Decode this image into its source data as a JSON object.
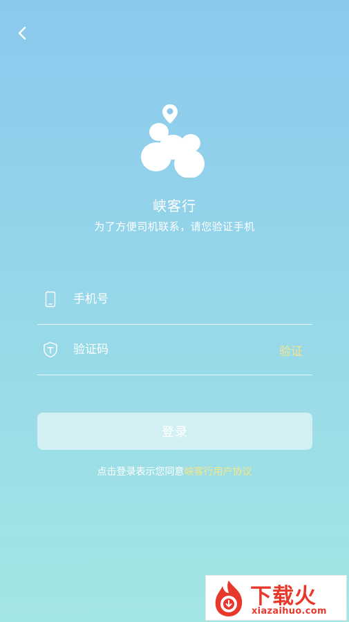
{
  "header": {
    "back_icon": "chevron-left-icon"
  },
  "brand": {
    "logo_icon": "app-logo-icon",
    "app_name": "峡客行",
    "subtitle": "为了方便司机联系，请您验证手机"
  },
  "form": {
    "phone": {
      "icon": "phone-icon",
      "placeholder": "手机号",
      "value": ""
    },
    "code": {
      "icon": "shield-icon",
      "placeholder": "验证码",
      "value": "",
      "verify_label": "验证"
    },
    "login_label": "登录"
  },
  "agreement": {
    "prefix": "点击登录表示您同意",
    "link": "峡客行用户协议"
  },
  "watermark": {
    "icon": "fire-logo-icon",
    "cn": "下载火",
    "en": "xiazaihuo.com"
  },
  "colors": {
    "gradient_top": "#8ac9ec",
    "gradient_bottom": "#a4e6e3",
    "accent_yellow": "#f4e58a",
    "watermark_red": "#e8382c"
  }
}
